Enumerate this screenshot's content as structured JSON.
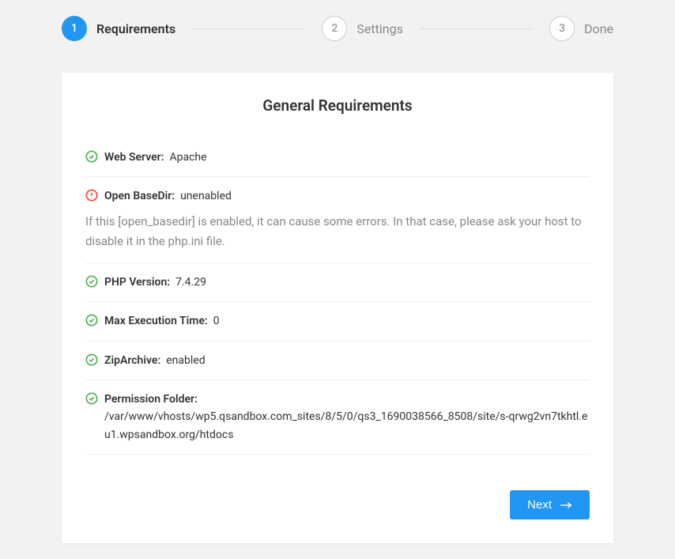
{
  "stepper": {
    "steps": [
      {
        "num": "1",
        "label": "Requirements",
        "active": true
      },
      {
        "num": "2",
        "label": "Settings",
        "active": false
      },
      {
        "num": "3",
        "label": "Done",
        "active": false
      }
    ]
  },
  "card": {
    "title": "General Requirements"
  },
  "requirements": [
    {
      "status": "ok",
      "label": "Web Server",
      "value": "Apache",
      "desc": null
    },
    {
      "status": "warn",
      "label": "Open BaseDir",
      "value": "unenabled",
      "desc": "If this [open_basedir] is enabled, it can cause some errors. In that case, please ask your host to disable it in the php.ini file."
    },
    {
      "status": "ok",
      "label": "PHP Version",
      "value": "7.4.29",
      "desc": null
    },
    {
      "status": "ok",
      "label": "Max Execution Time",
      "value": "0",
      "desc": null
    },
    {
      "status": "ok",
      "label": "ZipArchive",
      "value": "enabled",
      "desc": null
    },
    {
      "status": "ok",
      "label": "Permission Folder",
      "value": "/var/www/vhosts/wp5.qsandbox.com_sites/8/5/0/qs3_1690038566_8508/site/s-qrwg2vn7tkhtl.eu1.wpsandbox.org/htdocs",
      "desc": null,
      "multiline": true
    }
  ],
  "buttons": {
    "next": "Next"
  }
}
